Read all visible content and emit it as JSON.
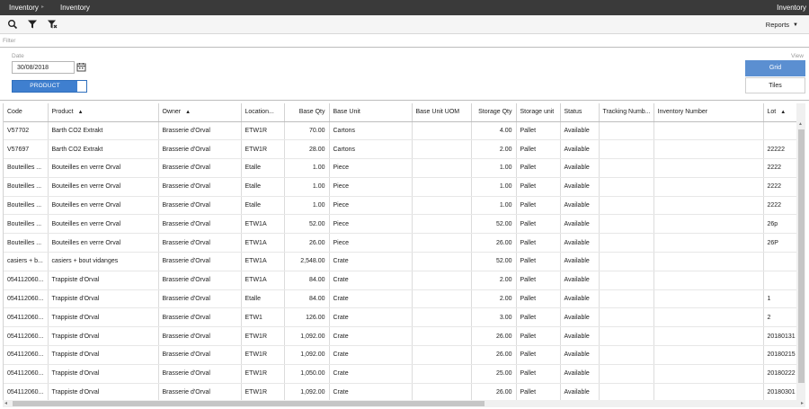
{
  "titlebar": {
    "crumb1": "Inventory",
    "crumb2": "Inventory",
    "right": "Inventory"
  },
  "toolbar": {
    "icons": [
      "search-icon",
      "filter-icon",
      "clear-filter-icon"
    ],
    "reports_label": "Reports"
  },
  "filter": {
    "label": "Filter"
  },
  "date": {
    "label": "Date",
    "value": "30/08/2018"
  },
  "toggle": {
    "label": "PRODUCT"
  },
  "view": {
    "label": "View",
    "grid": "Grid",
    "tiles": "Tiles"
  },
  "columns": [
    {
      "label": "Code",
      "sort": ""
    },
    {
      "label": "Product",
      "sort": "▲"
    },
    {
      "label": "Owner",
      "sort": "▲"
    },
    {
      "label": "Location...",
      "sort": ""
    },
    {
      "label": "Base Qty",
      "sort": ""
    },
    {
      "label": "Base Unit",
      "sort": ""
    },
    {
      "label": "Base Unit UOM",
      "sort": ""
    },
    {
      "label": "Storage Qty",
      "sort": ""
    },
    {
      "label": "Storage unit",
      "sort": ""
    },
    {
      "label": "Status",
      "sort": ""
    },
    {
      "label": "Tracking Numb...",
      "sort": ""
    },
    {
      "label": "Inventory Number",
      "sort": ""
    },
    {
      "label": "Lot",
      "sort": "▲"
    }
  ],
  "rows": [
    [
      "V57702",
      "Barth CO2 Extrakt",
      "Brasserie d'Orval",
      "ETW1R",
      "70.00",
      "Cartons",
      "",
      "4.00",
      "Pallet",
      "Available",
      "",
      "",
      ""
    ],
    [
      "V57697",
      "Barth CO2 Extrakt",
      "Brasserie d'Orval",
      "ETW1R",
      "28.00",
      "Cartons",
      "",
      "2.00",
      "Pallet",
      "Available",
      "",
      "",
      "22222"
    ],
    [
      "Bouteilles ...",
      "Bouteilles en verre Orval",
      "Brasserie d'Orval",
      "Etalle",
      "1.00",
      "Piece",
      "",
      "1.00",
      "Pallet",
      "Available",
      "",
      "",
      "2222"
    ],
    [
      "Bouteilles ...",
      "Bouteilles en verre Orval",
      "Brasserie d'Orval",
      "Etalle",
      "1.00",
      "Piece",
      "",
      "1.00",
      "Pallet",
      "Available",
      "",
      "",
      "2222"
    ],
    [
      "Bouteilles ...",
      "Bouteilles en verre Orval",
      "Brasserie d'Orval",
      "Etalle",
      "1.00",
      "Piece",
      "",
      "1.00",
      "Pallet",
      "Available",
      "",
      "",
      "2222"
    ],
    [
      "Bouteilles ...",
      "Bouteilles en verre Orval",
      "Brasserie d'Orval",
      "ETW1A",
      "52.00",
      "Piece",
      "",
      "52.00",
      "Pallet",
      "Available",
      "",
      "",
      "26p"
    ],
    [
      "Bouteilles ...",
      "Bouteilles en verre Orval",
      "Brasserie d'Orval",
      "ETW1A",
      "26.00",
      "Piece",
      "",
      "26.00",
      "Pallet",
      "Available",
      "",
      "",
      "26P"
    ],
    [
      "casiers + b...",
      "casiers + bout vidanges",
      "Brasserie d'Orval",
      "ETW1A",
      "2,548.00",
      "Crate",
      "",
      "52.00",
      "Pallet",
      "Available",
      "",
      "",
      ""
    ],
    [
      "054112060...",
      "Trappiste d'Orval",
      "Brasserie d'Orval",
      "ETW1A",
      "84.00",
      "Crate",
      "",
      "2.00",
      "Pallet",
      "Available",
      "",
      "",
      ""
    ],
    [
      "054112060...",
      "Trappiste d'Orval",
      "Brasserie d'Orval",
      "Etalle",
      "84.00",
      "Crate",
      "",
      "2.00",
      "Pallet",
      "Available",
      "",
      "",
      "1"
    ],
    [
      "054112060...",
      "Trappiste d'Orval",
      "Brasserie d'Orval",
      "ETW1",
      "126.00",
      "Crate",
      "",
      "3.00",
      "Pallet",
      "Available",
      "",
      "",
      "2"
    ],
    [
      "054112060...",
      "Trappiste d'Orval",
      "Brasserie d'Orval",
      "ETW1R",
      "1,092.00",
      "Crate",
      "",
      "26.00",
      "Pallet",
      "Available",
      "",
      "",
      "20180131"
    ],
    [
      "054112060...",
      "Trappiste d'Orval",
      "Brasserie d'Orval",
      "ETW1R",
      "1,092.00",
      "Crate",
      "",
      "26.00",
      "Pallet",
      "Available",
      "",
      "",
      "20180215"
    ],
    [
      "054112060...",
      "Trappiste d'Orval",
      "Brasserie d'Orval",
      "ETW1R",
      "1,050.00",
      "Crate",
      "",
      "25.00",
      "Pallet",
      "Available",
      "",
      "",
      "20180222"
    ],
    [
      "054112060...",
      "Trappiste d'Orval",
      "Brasserie d'Orval",
      "ETW1R",
      "1,092.00",
      "Crate",
      "",
      "26.00",
      "Pallet",
      "Available",
      "",
      "",
      "20180301"
    ]
  ]
}
